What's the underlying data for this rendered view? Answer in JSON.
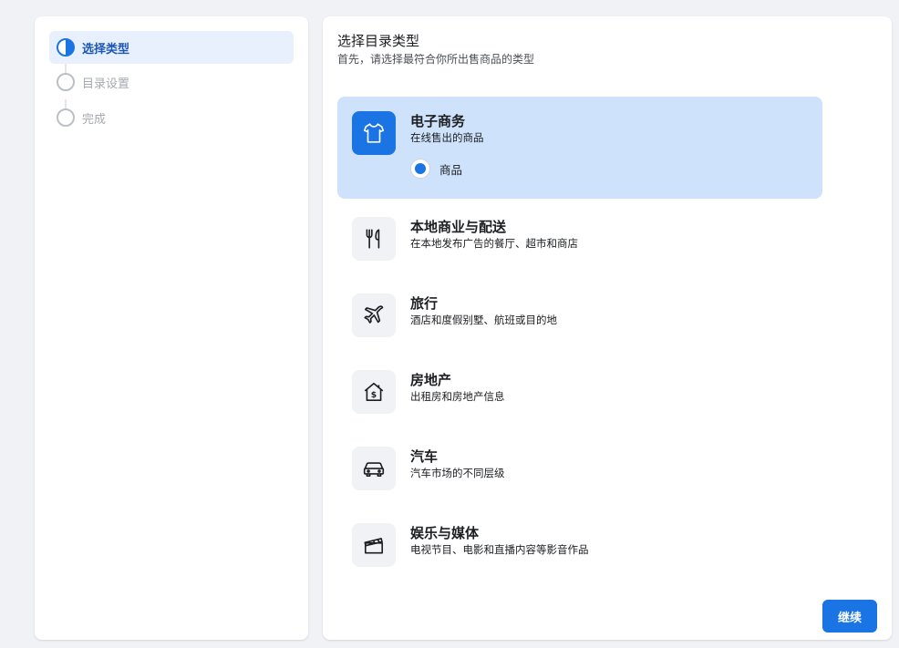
{
  "stepper": {
    "steps": [
      {
        "label": "选择类型",
        "state": "active"
      },
      {
        "label": "目录设置",
        "state": "pending"
      },
      {
        "label": "完成",
        "state": "pending"
      }
    ]
  },
  "main": {
    "title": "选择目录类型",
    "subtitle": "首先，请选择最符合你所出售商品的类型",
    "options": [
      {
        "title": "电子商务",
        "description": "在线售出的商品",
        "icon": "tshirt-icon",
        "selected": true,
        "sub_option": "商品"
      },
      {
        "title": "本地商业与配送",
        "description": "在本地发布广告的餐厅、超市和商店",
        "icon": "fork-knife-icon"
      },
      {
        "title": "旅行",
        "description": "酒店和度假别墅、航班或目的地",
        "icon": "airplane-icon"
      },
      {
        "title": "房地产",
        "description": "出租房和房地产信息",
        "icon": "house-dollar-icon"
      },
      {
        "title": "汽车",
        "description": "汽车市场的不同层级",
        "icon": "car-icon"
      },
      {
        "title": "娱乐与媒体",
        "description": "电视节目、电影和直播内容等影音作品",
        "icon": "clapperboard-icon"
      }
    ],
    "continue_label": "继续"
  },
  "colors": {
    "accent": "#1b74e4",
    "selected_bg": "#cfe2fb",
    "active_step_bg": "#e7f0fc"
  }
}
